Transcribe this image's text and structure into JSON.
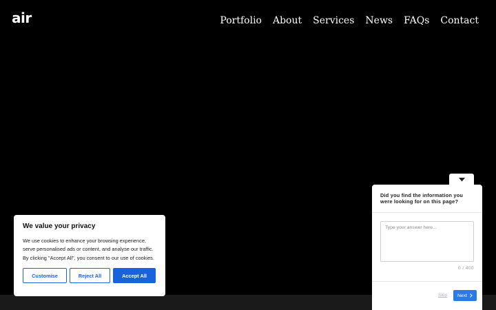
{
  "header": {
    "logo_text": "air",
    "nav": [
      {
        "label": "Portfolio"
      },
      {
        "label": "About"
      },
      {
        "label": "Services"
      },
      {
        "label": "News"
      },
      {
        "label": "FAQs"
      },
      {
        "label": "Contact"
      }
    ]
  },
  "cookie_banner": {
    "title": "We value your privacy",
    "text": "We use cookies to enhance your browsing experience, serve personalised ads or content, and analyse our traffic. By clicking \"Accept All\", you consent to our use of cookies.",
    "customise_label": "Customise",
    "reject_label": "Reject All",
    "accept_label": "Accept All",
    "accent_color": "#1863dc"
  },
  "feedback": {
    "collapse_icon": "caret-down-icon",
    "question": "Did you find the information you were looking for on this page?",
    "placeholder": "Type your answer here...",
    "counter": "0 / 400",
    "skip_label": "Skip",
    "next_label": "Next",
    "next_icon": "chevron-right-icon",
    "accent_color": "#2b7be5"
  },
  "colors": {
    "background": "#000000",
    "footer_strip": "#1a1a1a",
    "text_light": "#ffffff"
  }
}
